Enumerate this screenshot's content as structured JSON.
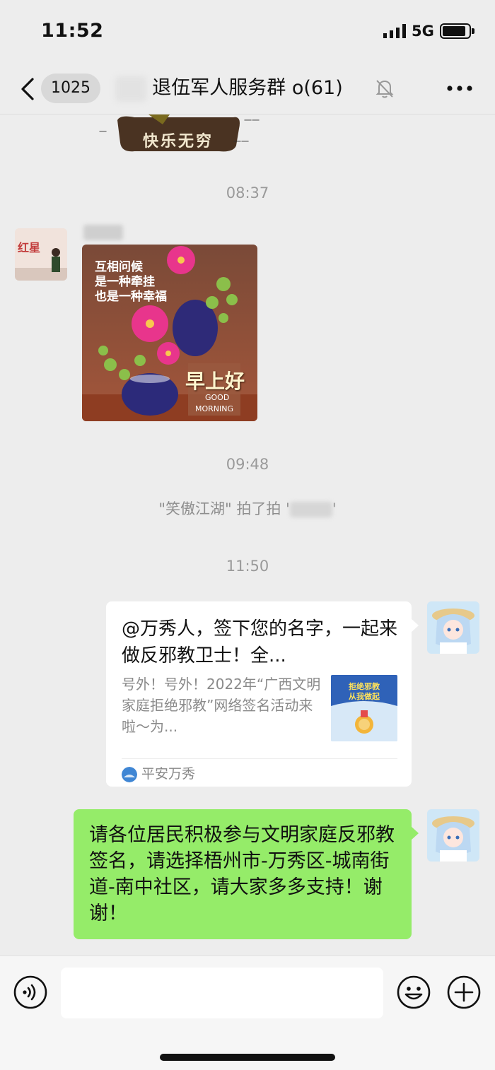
{
  "status_bar": {
    "time": "11:52",
    "network": "5G"
  },
  "header": {
    "unread_count": "1025",
    "title": "退伍军人服务群 o(61)"
  },
  "messages": {
    "top_image_text": "快乐无穷",
    "timestamps": [
      "08:37",
      "09:48",
      "11:50"
    ],
    "greeting_image": {
      "text1": "互相问候",
      "text2": "是一种牵挂",
      "text3": "也是一种幸福",
      "big": "早上好",
      "good": "GOOD",
      "morning": "MORNING"
    },
    "avatar_text": "红星",
    "system_notice": {
      "actor": "\"笑傲江湖\" 拍了拍 '",
      "end": "'"
    },
    "link_card": {
      "title": "@万秀人，签下您的名字，一起来做反邪教卫士！全...",
      "description": "号外！号外！2022年“广西文明家庭拒绝邪教”网络签名活动来啦～为...",
      "thumb_line1": "拒绝邪教",
      "thumb_line2": "从我做起",
      "source": "平安万秀"
    },
    "text_message": "请各位居民积极参与文明家庭反邪教签名，请选择梧州市-万秀区-城南街道-南中社区，请大家多多支持！谢谢！"
  },
  "input_bar": {
    "placeholder": ""
  },
  "colors": {
    "bubble_green": "#95ec69",
    "background": "#ededed"
  }
}
